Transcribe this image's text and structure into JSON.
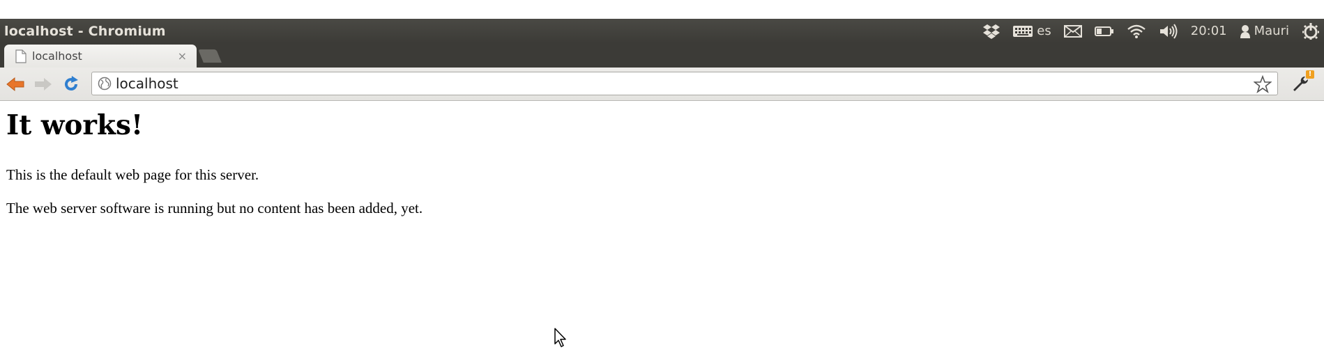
{
  "window": {
    "title": "localhost - Chromium"
  },
  "system_tray": {
    "keyboard_layout": "es",
    "clock": "20:01",
    "user": "Mauri",
    "icons": [
      "dropbox-icon",
      "keyboard-icon",
      "mail-icon",
      "battery-icon",
      "wifi-icon",
      "volume-icon",
      "user-icon",
      "power-gear-icon"
    ]
  },
  "tabs": [
    {
      "title": "localhost",
      "close": "×"
    }
  ],
  "toolbar": {
    "url": "localhost",
    "badge": "!"
  },
  "page": {
    "heading": "It works!",
    "paragraph1": "This is the default web page for this server.",
    "paragraph2": "The web server software is running but no content has been added, yet."
  },
  "colors": {
    "panel": "#3c3b37",
    "panel_text": "#dfdbd2",
    "back_arrow": "#e8762b",
    "reload": "#2f7fd0",
    "badge": "#f0a020"
  }
}
